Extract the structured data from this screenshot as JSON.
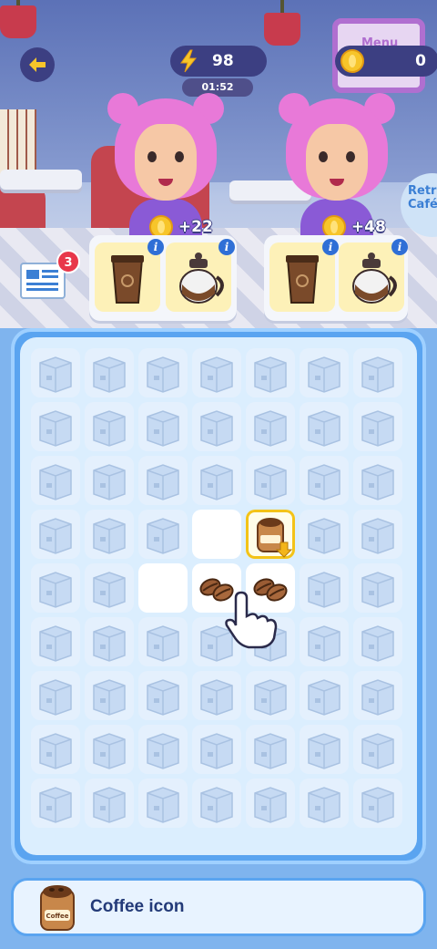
{
  "hud": {
    "energy": "98",
    "timer": "01:52",
    "coins": "0"
  },
  "scene": {
    "menu_sign": "Menu",
    "retro_sign": "Retro Café"
  },
  "customers": [
    {
      "reward": "+22",
      "order": [
        "coffee-cup-icon",
        "coffee-pot-icon"
      ]
    },
    {
      "reward": "+48",
      "order": [
        "coffee-cup-icon",
        "coffee-pot-icon"
      ]
    }
  ],
  "news": {
    "badge_count": "3"
  },
  "board": {
    "columns": 7,
    "rows": 9,
    "open_cells": [
      [
        3,
        3
      ],
      [
        4,
        2
      ],
      [
        4,
        3
      ],
      [
        4,
        4
      ]
    ],
    "items": [
      {
        "row": 3,
        "col": 4,
        "icon": "coffee-bag-icon",
        "label": "Coffee",
        "selected": true
      },
      {
        "row": 4,
        "col": 3,
        "icon": "coffee-beans-icon"
      },
      {
        "row": 4,
        "col": 4,
        "icon": "coffee-beans-icon"
      }
    ]
  },
  "info_bar": {
    "label": "Coffee icon",
    "icon_label": "Coffee"
  },
  "colors": {
    "hud_bg": "#3c3f82",
    "board_frame": "#5aa4f0",
    "board_bg": "#dbeefe",
    "hair": "#e879d8",
    "selected_outline": "#f3c318"
  }
}
